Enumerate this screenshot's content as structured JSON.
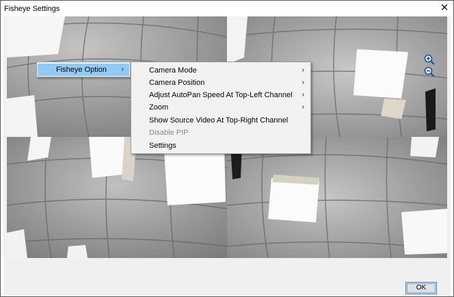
{
  "window": {
    "title": "Fisheye Settings",
    "close_glyph": "✕"
  },
  "video": {
    "zoom_in_icon": "zoom-in-icon",
    "zoom_out_icon": "zoom-out-icon"
  },
  "context_menu": {
    "main_item": {
      "label": "Fisheye Option",
      "arrow": "›"
    },
    "submenu": [
      {
        "label": "Camera Mode",
        "arrow": "›",
        "enabled": true
      },
      {
        "label": "Camera Position",
        "arrow": "›",
        "enabled": true
      },
      {
        "label": "Adjust AutoPan Speed At Top-Left Channel",
        "arrow": "›",
        "enabled": true
      },
      {
        "label": "Zoom",
        "arrow": "›",
        "enabled": true
      },
      {
        "label": "Show Source Video At Top-Right Channel",
        "arrow": "",
        "enabled": true
      },
      {
        "label": "Disable PIP",
        "arrow": "",
        "enabled": false
      },
      {
        "label": "Settings",
        "arrow": "",
        "enabled": true
      }
    ],
    "highlight_color": "#91c9f7"
  },
  "footer": {
    "ok_label": "OK"
  }
}
